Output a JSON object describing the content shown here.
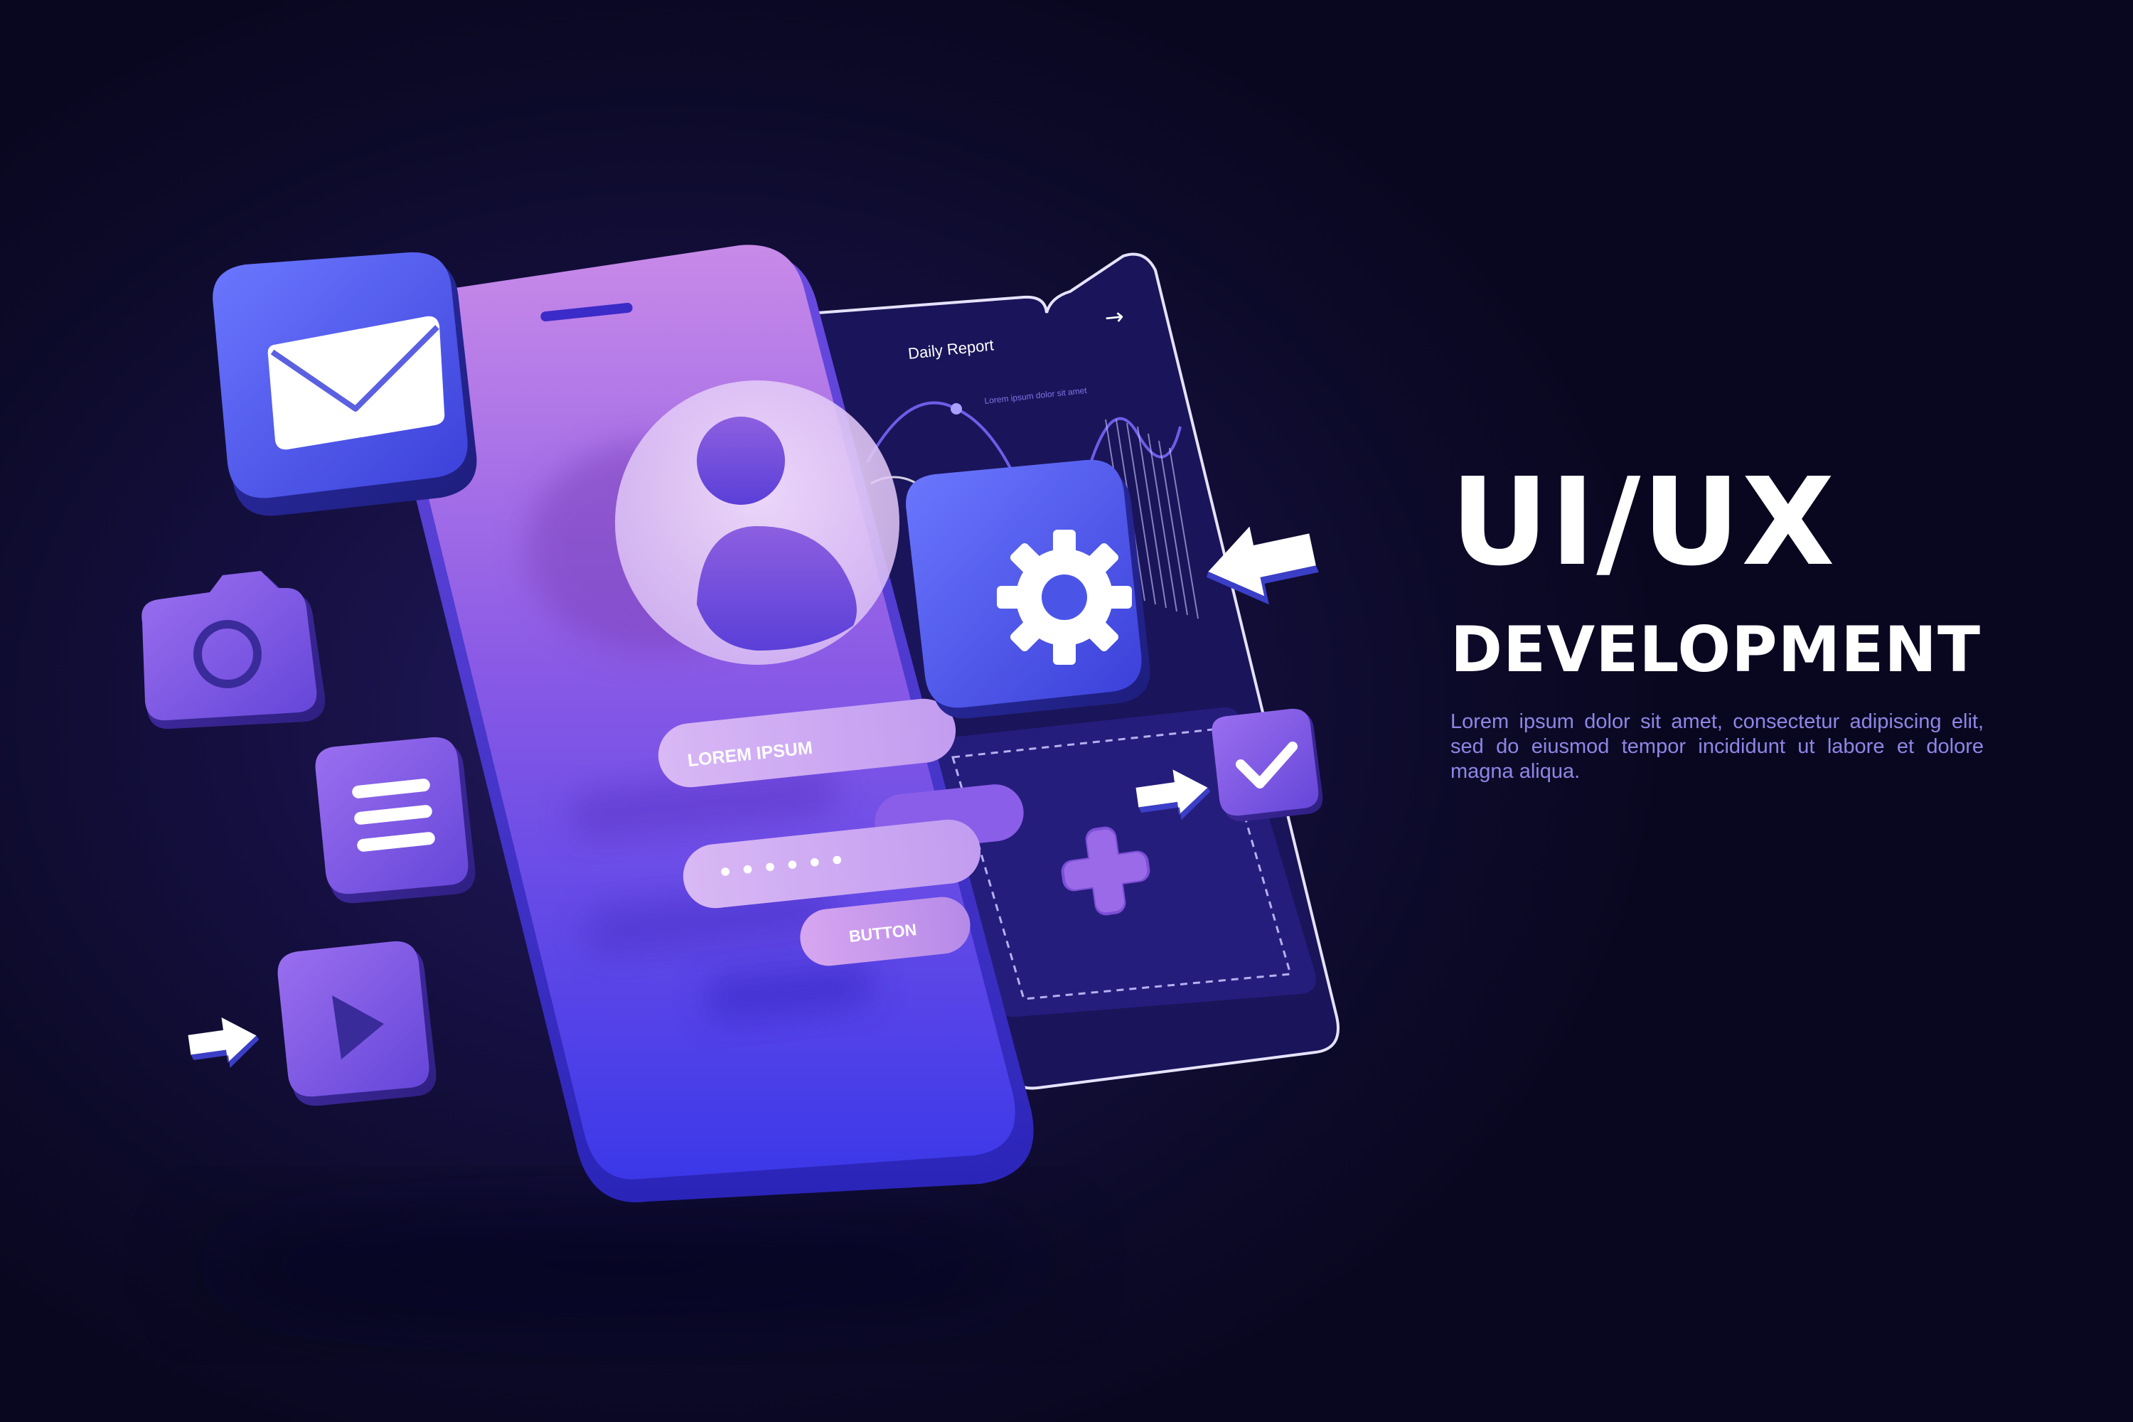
{
  "headline": {
    "title": "UI/UX",
    "subtitle": "DEVELOPMENT",
    "body": "Lorem ipsum dolor sit amet, consectetur adipiscing elit, sed do eiusmod tempor incididunt ut labore et dolore magna aliqua."
  },
  "back_phone": {
    "report_title": "Daily Report",
    "report_caption": "Lorem ipsum dolor sit amet"
  },
  "front_phone": {
    "username_field": "LOREM IPSUM",
    "password_dots": "••••••",
    "button_label": "BUTTON"
  },
  "colors": {
    "background": "#0c0a28",
    "accent_blue": "#4a55e8",
    "accent_purple": "#8a5ae6",
    "text_light": "#ffffff",
    "text_muted": "#8f86e6"
  },
  "icons": [
    "mail-icon",
    "camera-icon",
    "menu-icon",
    "play-icon",
    "gear-icon",
    "check-icon",
    "plus-icon",
    "profile-icon",
    "arrow-icon"
  ]
}
